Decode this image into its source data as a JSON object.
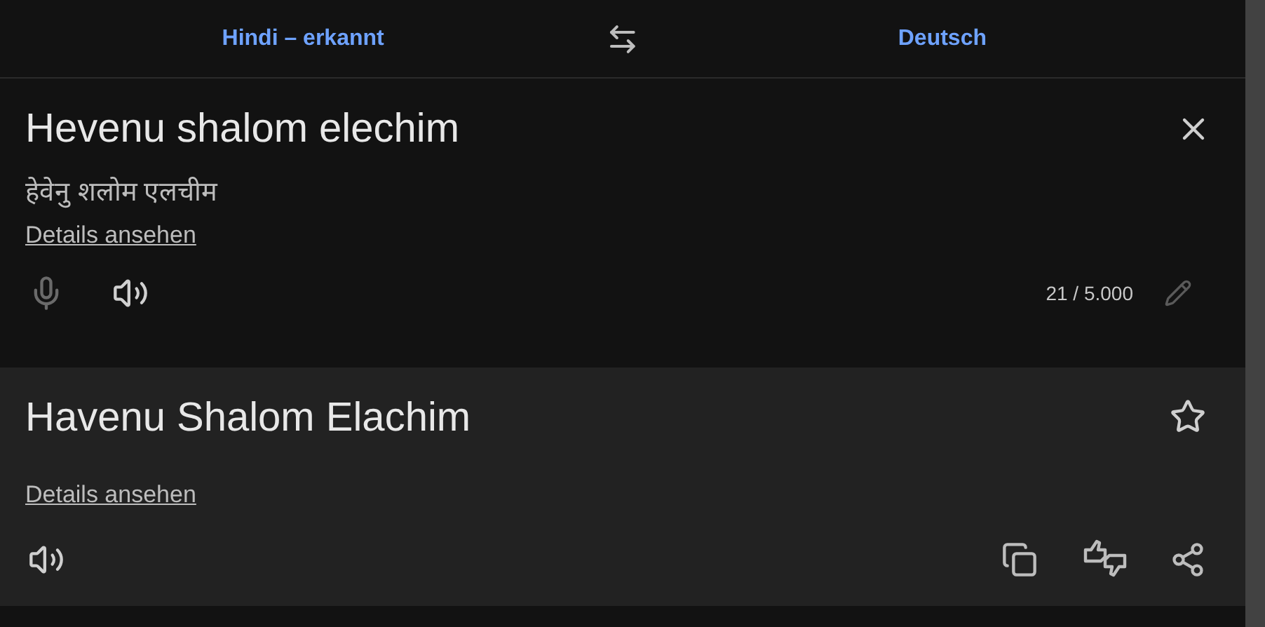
{
  "languages": {
    "source": "Hindi – erkannt",
    "target": "Deutsch"
  },
  "source": {
    "text": "Hevenu shalom elechim",
    "transliteration": "हेवेनु शलोम एलचीम",
    "details_link": "Details ansehen",
    "microphone": {
      "disabled": true
    },
    "char_count": "21 / 5.000"
  },
  "target": {
    "text": "Havenu Shalom Elachim",
    "details_link": "Details ansehen"
  }
}
